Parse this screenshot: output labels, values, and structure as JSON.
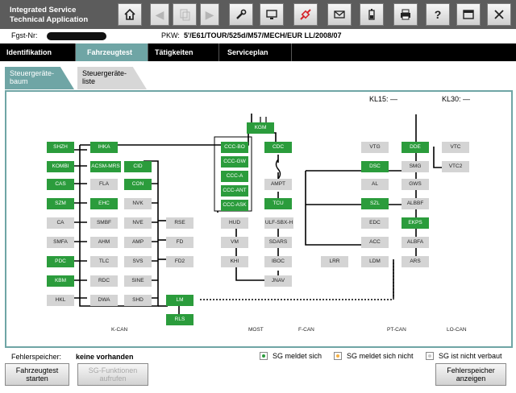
{
  "app": {
    "title_line1": "Integrated Service",
    "title_line2": "Technical Application"
  },
  "toolbar": {
    "buttons": [
      "home-icon",
      "back-icon",
      "pages-icon",
      "forward-icon",
      "wrench-icon",
      "screen-icon",
      "plug-icon",
      "envelope-icon",
      "battery-icon",
      "printer-icon",
      "help-icon",
      "window-icon",
      "close-icon"
    ]
  },
  "vehicle": {
    "fgst_label": "Fgst-Nr:",
    "pkw_label": "PKW:",
    "pkw_value": "5'/E61/TOUR/525d/M57/MECH/EUR LL/2008/07"
  },
  "main_tabs": [
    "Identifikation",
    "Fahrzeugtest",
    "Tätigkeiten",
    "Serviceplan"
  ],
  "sub_tabs": [
    {
      "line1": "Steuergeräte-",
      "line2": "baum"
    },
    {
      "line1": "Steuergeräte-",
      "line2": "liste"
    }
  ],
  "kl": {
    "kl15": "KL15: —",
    "kl30": "KL30: —"
  },
  "nodes": [
    {
      "id": "kgm",
      "label": "KGM",
      "status": "ok"
    },
    {
      "id": "shzh",
      "label": "SHZH",
      "status": "ok"
    },
    {
      "id": "ihka",
      "label": "IHKA",
      "status": "ok"
    },
    {
      "id": "kombi",
      "label": "KOMBI",
      "status": "ok"
    },
    {
      "id": "acsm",
      "label": "ACSM-MRS",
      "status": "ok"
    },
    {
      "id": "cid",
      "label": "CID",
      "status": "ok"
    },
    {
      "id": "cas",
      "label": "CAS",
      "status": "ok"
    },
    {
      "id": "fla",
      "label": "FLA",
      "status": "na"
    },
    {
      "id": "con",
      "label": "CON",
      "status": "ok"
    },
    {
      "id": "szm",
      "label": "SZM",
      "status": "ok"
    },
    {
      "id": "ehc",
      "label": "EHC",
      "status": "ok"
    },
    {
      "id": "nvk",
      "label": "NVK",
      "status": "na"
    },
    {
      "id": "ca",
      "label": "CA",
      "status": "na"
    },
    {
      "id": "smbf",
      "label": "SMBF",
      "status": "na"
    },
    {
      "id": "nve",
      "label": "NVE",
      "status": "na"
    },
    {
      "id": "rse",
      "label": "RSE",
      "status": "na"
    },
    {
      "id": "smfa",
      "label": "SMFA",
      "status": "na"
    },
    {
      "id": "ahm",
      "label": "AHM",
      "status": "na"
    },
    {
      "id": "amp",
      "label": "AMP",
      "status": "na"
    },
    {
      "id": "fd",
      "label": "FD",
      "status": "na"
    },
    {
      "id": "pdc",
      "label": "PDC",
      "status": "ok"
    },
    {
      "id": "tlc",
      "label": "TLC",
      "status": "na"
    },
    {
      "id": "svs",
      "label": "SVS",
      "status": "na"
    },
    {
      "id": "fd2",
      "label": "FD2",
      "status": "na"
    },
    {
      "id": "kbm",
      "label": "KBM",
      "status": "ok"
    },
    {
      "id": "rdc",
      "label": "RDC",
      "status": "na"
    },
    {
      "id": "sine",
      "label": "SINE",
      "status": "na"
    },
    {
      "id": "hkl",
      "label": "HKL",
      "status": "na"
    },
    {
      "id": "dwa",
      "label": "DWA",
      "status": "na"
    },
    {
      "id": "shd",
      "label": "SHD",
      "status": "na"
    },
    {
      "id": "lm",
      "label": "LM",
      "status": "ok"
    },
    {
      "id": "rls",
      "label": "RLS",
      "status": "ok"
    },
    {
      "id": "cccbo",
      "label": "CCC-BO",
      "status": "ok"
    },
    {
      "id": "cccgw",
      "label": "CCC-GW",
      "status": "ok"
    },
    {
      "id": "ccca",
      "label": "CCC-A",
      "status": "ok"
    },
    {
      "id": "cccant",
      "label": "CCC-ANT",
      "status": "ok"
    },
    {
      "id": "cccask",
      "label": "CCC-ASK",
      "status": "ok"
    },
    {
      "id": "hud",
      "label": "HUD",
      "status": "na"
    },
    {
      "id": "vm",
      "label": "VM",
      "status": "na"
    },
    {
      "id": "khi",
      "label": "KHI",
      "status": "na"
    },
    {
      "id": "cdc",
      "label": "CDC",
      "status": "ok"
    },
    {
      "id": "ampt",
      "label": "AMPT",
      "status": "na"
    },
    {
      "id": "tcu",
      "label": "TCU",
      "status": "ok"
    },
    {
      "id": "ulf",
      "label": "ULF-SBX-H",
      "status": "na"
    },
    {
      "id": "sdars",
      "label": "SDARS",
      "status": "na"
    },
    {
      "id": "iboc",
      "label": "IBOC",
      "status": "na"
    },
    {
      "id": "jnav",
      "label": "JNAV",
      "status": "na"
    },
    {
      "id": "vtg",
      "label": "VTG",
      "status": "na"
    },
    {
      "id": "dde",
      "label": "DDE",
      "status": "ok"
    },
    {
      "id": "vtc",
      "label": "VTC",
      "status": "na"
    },
    {
      "id": "dsc",
      "label": "DSC",
      "status": "ok"
    },
    {
      "id": "smg",
      "label": "SMG",
      "status": "na"
    },
    {
      "id": "vtc2",
      "label": "VTC2",
      "status": "na"
    },
    {
      "id": "al",
      "label": "AL",
      "status": "na"
    },
    {
      "id": "gws",
      "label": "GWS",
      "status": "na"
    },
    {
      "id": "szl",
      "label": "SZL",
      "status": "ok"
    },
    {
      "id": "albbf",
      "label": "ALBBF",
      "status": "na"
    },
    {
      "id": "edc",
      "label": "EDC",
      "status": "na"
    },
    {
      "id": "ekps",
      "label": "EKPS",
      "status": "ok"
    },
    {
      "id": "acc",
      "label": "ACC",
      "status": "na"
    },
    {
      "id": "albfa",
      "label": "ALBFA",
      "status": "na"
    },
    {
      "id": "lrr",
      "label": "LRR",
      "status": "na"
    },
    {
      "id": "ldm",
      "label": "LDM",
      "status": "na"
    },
    {
      "id": "ars",
      "label": "ARS",
      "status": "na"
    }
  ],
  "buses": [
    "K-CAN",
    "MOST",
    "F-CAN",
    "PT-CAN",
    "LO-CAN"
  ],
  "bottom": {
    "fehlerspeicher_label": "Fehlerspeicher:",
    "fehlerspeicher_value": "keine vorhanden",
    "legend": [
      "SG meldet sich",
      "SG meldet sich nicht",
      "SG ist nicht verbaut"
    ]
  },
  "buttons": {
    "test_line1": "Fahrzeugtest",
    "test_line2": "starten",
    "sgf_line1": "SG-Funktionen",
    "sgf_line2": "aufrufen",
    "fsp_line1": "Fehlerspeicher",
    "fsp_line2": "anzeigen"
  },
  "colors": {
    "ok": "#2b9c3c",
    "not_responding": "#f5b041",
    "not_installed": "#d4d4d4",
    "accent": "#6fa5a5"
  }
}
